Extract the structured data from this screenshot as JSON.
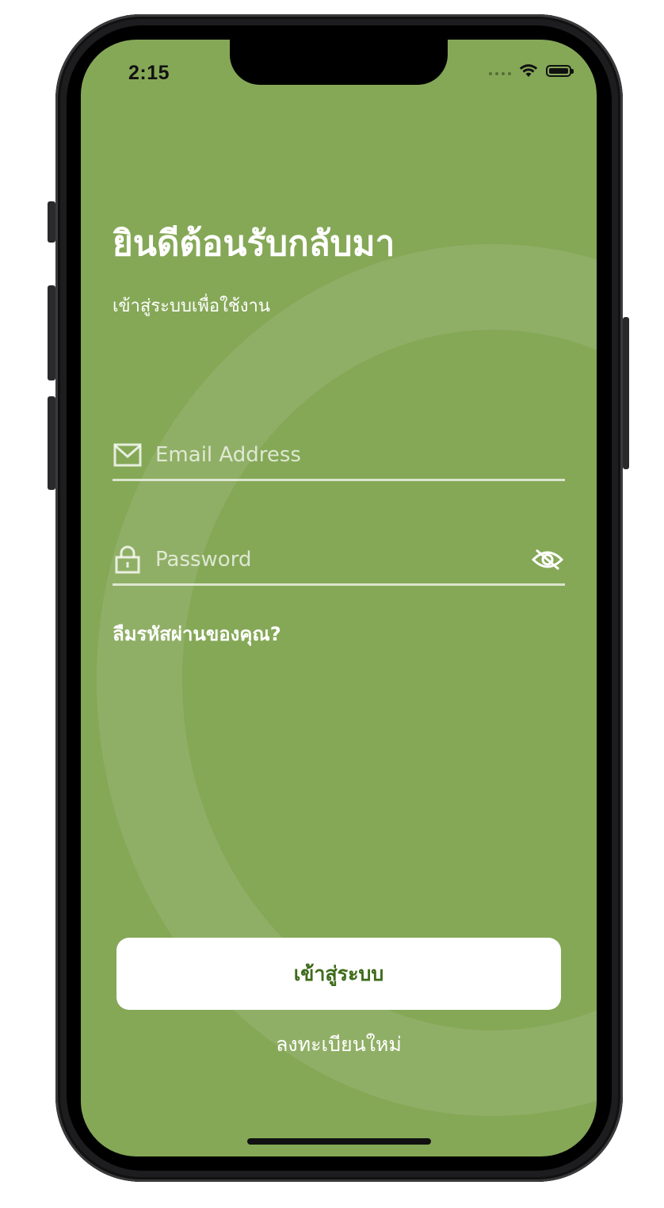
{
  "status_bar": {
    "time": "2:15"
  },
  "login": {
    "title": "ยินดีต้อนรับกลับมา",
    "subtitle": "เข้าสู่ระบบเพื่อใช้งาน",
    "email_placeholder": "Email Address",
    "password_placeholder": "Password",
    "forgot_password": "ลืมรหัสผ่านของคุณ?",
    "login_button": "เข้าสู่ระบบ",
    "register_link": "ลงทะเบียนใหม่"
  },
  "icons": {
    "email": "mail-icon",
    "password": "lock-icon",
    "toggle_visibility": "eye-off-icon"
  },
  "colors": {
    "background": "#85a857",
    "button_text": "#3e6b1a",
    "button_background": "#ffffff"
  }
}
